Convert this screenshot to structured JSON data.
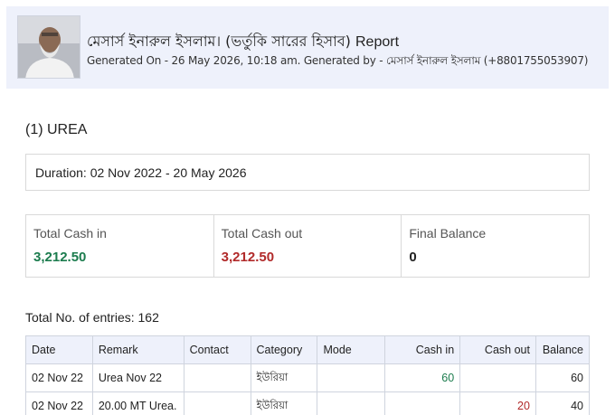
{
  "header": {
    "title_bn": "মেসার্স ইনারুল ইসলাম। (ভর্তুকি সারের হিসাব)",
    "title_suffix": "Report",
    "subtitle": "Generated On - 26 May 2026, 10:18 am. Generated by - মেসার্স ইনারুল ইসলাম (+8801755053907)"
  },
  "section": {
    "title": "(1) UREA"
  },
  "duration": {
    "label": "Duration:",
    "value": "02 Nov 2022 - 20 May 2026"
  },
  "summary": {
    "cash_in_label": "Total Cash in",
    "cash_in_value": "3,212.50",
    "cash_out_label": "Total Cash out",
    "cash_out_value": "3,212.50",
    "balance_label": "Final Balance",
    "balance_value": "0"
  },
  "entries": {
    "text": "Total No. of entries: 162"
  },
  "table": {
    "columns": [
      "Date",
      "Remark",
      "Contact",
      "Category",
      "Mode",
      "Cash in",
      "Cash out",
      "Balance"
    ],
    "rows": [
      {
        "date": "02 Nov 22",
        "remark": "Urea Nov 22",
        "contact": "",
        "category": "ইউরিয়া",
        "mode": "",
        "cash_in": "60",
        "cash_out": "",
        "balance": "60"
      },
      {
        "date": "02 Nov 22",
        "remark": "20.00 MT Urea.",
        "contact": "",
        "category": "ইউরিয়া",
        "mode": "",
        "cash_in": "",
        "cash_out": "20",
        "balance": "40"
      }
    ]
  },
  "colors": {
    "cash_in": "#1c7c4e",
    "cash_out": "#b12a2a",
    "header_bg": "#eef1fb"
  }
}
